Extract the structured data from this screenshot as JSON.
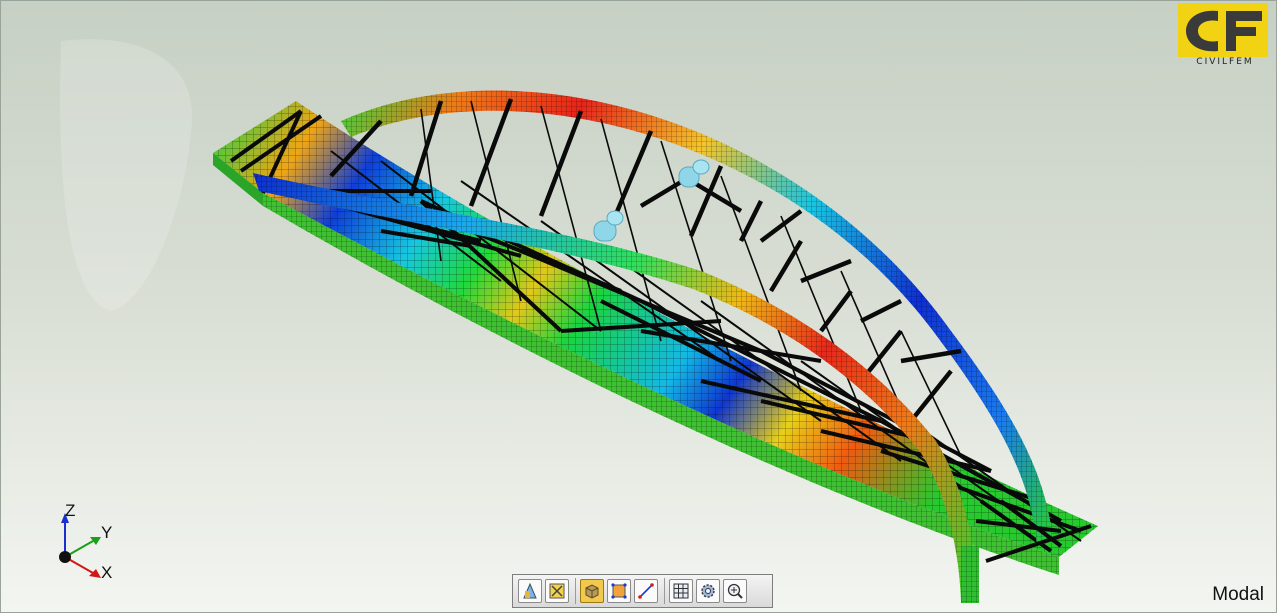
{
  "app": {
    "brand_text": "CIVILFEM",
    "logo_letters": "CF",
    "analysis_label": "Modal"
  },
  "axes": {
    "z": "Z",
    "y": "Y",
    "x": "X"
  },
  "toolbar": {
    "buttons": [
      {
        "icon": "material-view-icon",
        "active": false
      },
      {
        "icon": "section-cut-icon",
        "active": false
      },
      {
        "icon": "solid-view-icon",
        "active": true
      },
      {
        "icon": "select-nodes-icon",
        "active": false
      },
      {
        "icon": "measure-line-icon",
        "active": false
      },
      {
        "icon": "mesh-grid-icon",
        "active": false
      },
      {
        "icon": "settings-gear-icon",
        "active": false
      },
      {
        "icon": "zoom-fit-icon",
        "active": false
      }
    ]
  },
  "colors": {
    "logo_yellow": "#f1d313",
    "contour_low": "#0b2fd6",
    "contour_mid": "#18d840",
    "contour_high": "#e01b10",
    "axis_z": "#1a2fd0",
    "axis_y": "#18a018",
    "axis_x": "#d01818"
  }
}
